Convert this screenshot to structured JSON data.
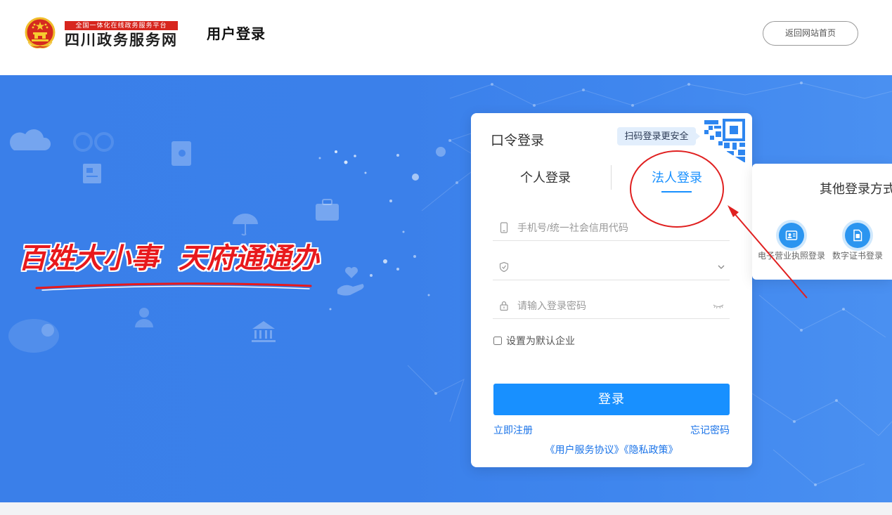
{
  "header": {
    "logo_banner": "全国一体化在线政务服务平台",
    "site_name": "四川政务服务网",
    "page_title": "用户登录",
    "back_home_label": "返回网站首页"
  },
  "hero": {
    "slogan": "百姓大小事  天府通通办"
  },
  "login_card": {
    "title": "口令登录",
    "qr_tooltip": "扫码登录更安全",
    "tabs": [
      {
        "label": "个人登录",
        "active": false
      },
      {
        "label": "法人登录",
        "active": true
      }
    ],
    "fields": {
      "account_placeholder": "手机号/统一社会信用代码",
      "account_icon": "mobile-phone-icon",
      "company_icon": "shield-icon",
      "password_placeholder": "请输入登录密码",
      "password_icon": "lock-icon"
    },
    "default_company_label": "设置为默认企业",
    "default_company_checked": false,
    "submit_label": "登录",
    "register_link": "立即注册",
    "forgot_link": "忘记密码",
    "agreement": [
      "《用户服务协议》",
      "《隐私政策》"
    ]
  },
  "other_login": {
    "title": "其他登录方式",
    "methods": [
      {
        "label": "电子营业执照登录",
        "icon": "business-license-icon"
      },
      {
        "label": "数字证书登录",
        "icon": "digital-certificate-icon"
      }
    ]
  },
  "colors": {
    "primary": "#1890ff",
    "link": "#1a73e8",
    "hero_bg": "#3b80ea",
    "slogan_red": "#e8191c",
    "annotation_red": "#e02020"
  }
}
